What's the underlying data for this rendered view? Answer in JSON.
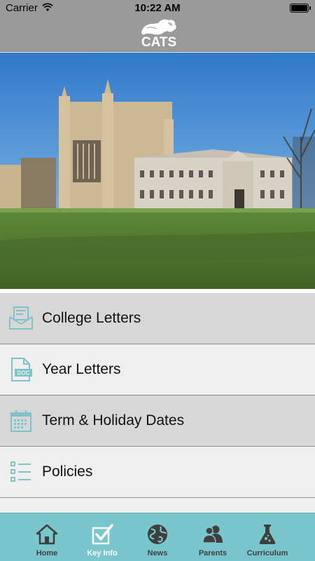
{
  "status_bar": {
    "carrier": "Carrier",
    "time": "10:22 AM"
  },
  "header": {
    "logo_text": "CATS",
    "logo_icon": "lion-icon"
  },
  "hero": {
    "image": "college-chapel-photo"
  },
  "menu": {
    "items": [
      {
        "label": "College Letters",
        "icon": "envelope-letter-icon"
      },
      {
        "label": "Year Letters",
        "icon": "doc-file-icon"
      },
      {
        "label": "Term & Holiday Dates",
        "icon": "calendar-icon"
      },
      {
        "label": "Policies",
        "icon": "checklist-icon"
      }
    ]
  },
  "tab_bar": {
    "active_tab": "Key Info",
    "tabs": [
      {
        "label": "Home",
        "icon": "house-icon"
      },
      {
        "label": "Key Info",
        "icon": "checkbox-icon"
      },
      {
        "label": "News",
        "icon": "globe-icon"
      },
      {
        "label": "Parents",
        "icon": "people-icon"
      },
      {
        "label": "Curriculum",
        "icon": "flask-icon"
      }
    ]
  },
  "colors": {
    "header_bg": "#9a9a9a",
    "tab_bar_bg": "#79c6cc",
    "icon_accent": "#7fc3c9",
    "row_dark": "#d7d7d7",
    "row_light": "#efefef"
  }
}
